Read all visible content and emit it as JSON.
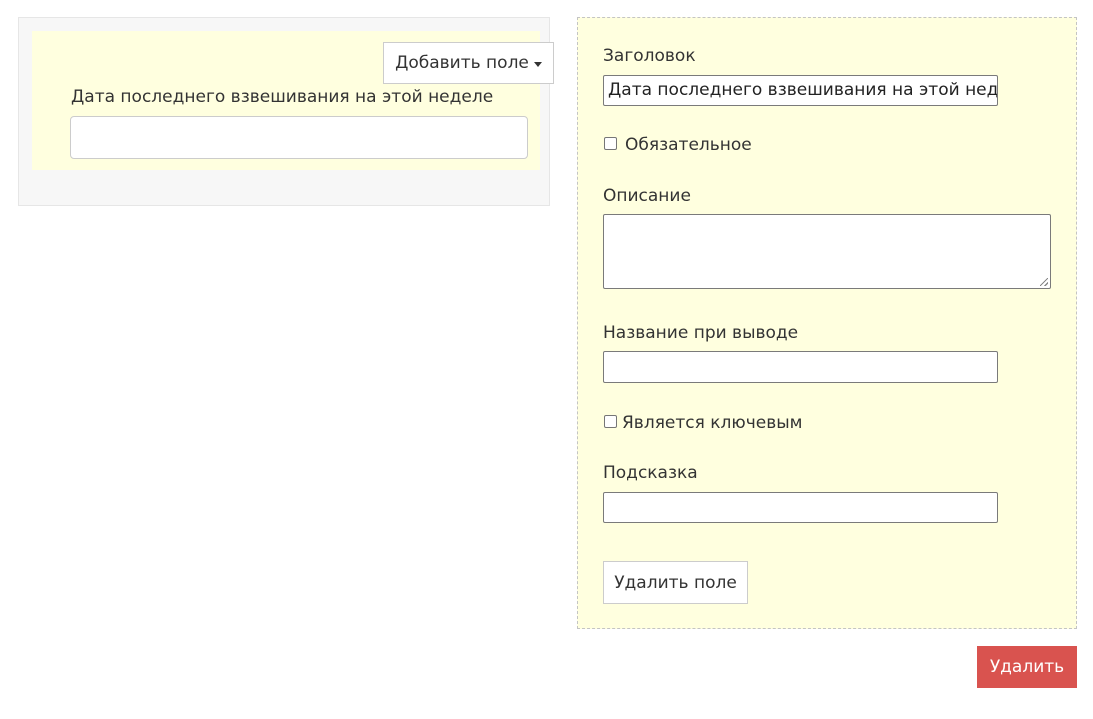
{
  "preview": {
    "add_field_label": "Добавить поле",
    "field_label": "Дата последнего взвешивания на этой неделе",
    "field_value": ""
  },
  "settings": {
    "title_label": "Заголовок",
    "title_value": "Дата последнего взвешивания на этой неделе",
    "required_label": "Обязательное",
    "required_checked": false,
    "description_label": "Описание",
    "description_value": "",
    "output_name_label": "Название при выводе",
    "output_name_value": "",
    "is_key_label": "Является ключевым",
    "is_key_checked": false,
    "hint_label": "Подсказка",
    "hint_value": "",
    "delete_field_label": "Удалить поле"
  },
  "actions": {
    "delete_label": "Удалить"
  },
  "colors": {
    "panel_bg": "#ffffdf",
    "delete_bg": "#d9534f"
  }
}
